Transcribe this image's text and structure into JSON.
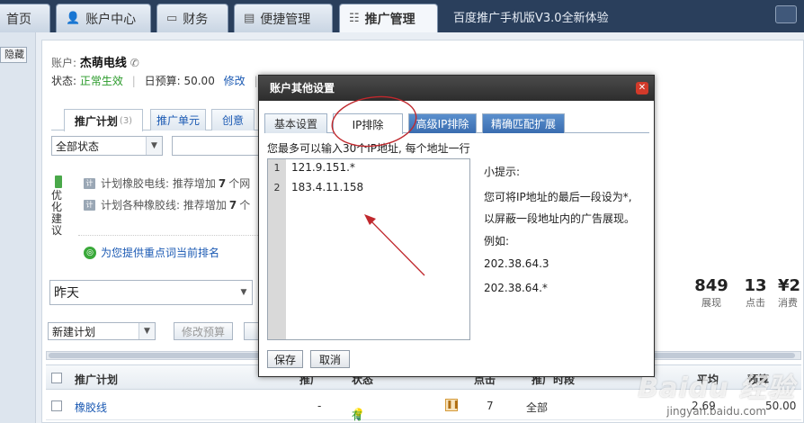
{
  "topnav": {
    "tabs": [
      {
        "label": "首页",
        "icon": "home-icon"
      },
      {
        "label": "账户中心",
        "icon": "user-icon"
      },
      {
        "label": "财务",
        "icon": "wallet-icon"
      },
      {
        "label": "便捷管理",
        "icon": "calendar-icon"
      },
      {
        "label": "推广管理",
        "icon": "grid-icon"
      }
    ],
    "promo": "百度推广手机版V3.0全新体验",
    "promo_icon": "apple-icon"
  },
  "leftstrip": {
    "hide_label": "隐藏"
  },
  "account": {
    "prefix": "账户:",
    "name": "杰萌电线",
    "status_label": "状态:",
    "status_value": "正常生效",
    "budget_label": "日预算:",
    "budget_value": "50.00",
    "edit_link": "修改"
  },
  "subtabs": [
    {
      "label": "推广计划",
      "count": "(3)"
    },
    {
      "label": "推广单元"
    },
    {
      "label": "创意"
    }
  ],
  "filters": {
    "status_select": "全部状态",
    "date_select": "昨天"
  },
  "suggestions": {
    "title": "优化建议",
    "items": [
      {
        "text": "计划橡胶电线: 推荐增加",
        "num": "7",
        "suffix": "个网"
      },
      {
        "text": "计划各种橡胶线: 推荐增加",
        "num": "7",
        "suffix": "个"
      }
    ],
    "rank_link": "为您提供重点词当前排名"
  },
  "stats": [
    {
      "value": "849",
      "label": "展现"
    },
    {
      "value": "13",
      "label": "点击"
    },
    {
      "value": "¥2",
      "label": "消费"
    }
  ],
  "toolbar": {
    "new_plan": "新建计划",
    "edit_budget": "修改预算"
  },
  "table": {
    "headers": [
      "推广计划",
      "推广",
      "状态",
      "点击",
      "推广时段",
      "平均",
      "预算"
    ],
    "rows": [
      {
        "name": "橡胶线",
        "col2": "-",
        "status": "有效",
        "clicks": "7",
        "period": "全部",
        "avg": "2.69",
        "budget": "50.00"
      }
    ]
  },
  "modal": {
    "title": "账户其他设置",
    "tabs": [
      "基本设置",
      "IP排除",
      "高级IP排除",
      "精确匹配扩展"
    ],
    "hint": "您最多可以输入30个IP地址, 每个地址一行",
    "lines": [
      {
        "n": "1",
        "ip": "121.9.151.*"
      },
      {
        "n": "2",
        "ip": "183.4.11.158"
      }
    ],
    "tips": {
      "title": "小提示:",
      "line1": "您可将IP地址的最后一段设为*,",
      "line2": "以屏蔽一段地址内的广告展现。",
      "example": "例如:",
      "ex1": "202.38.64.3",
      "ex2": "202.38.64.*"
    },
    "save": "保存",
    "cancel": "取消"
  },
  "watermark": {
    "main": "Baidu 经验",
    "sub": "jingyan.baidu.com"
  },
  "colors": {
    "annotation_red": "#c0282d",
    "link_blue": "#1a59b3",
    "status_green": "#2a9a2a",
    "nav_dark": "#2a3f5c"
  }
}
